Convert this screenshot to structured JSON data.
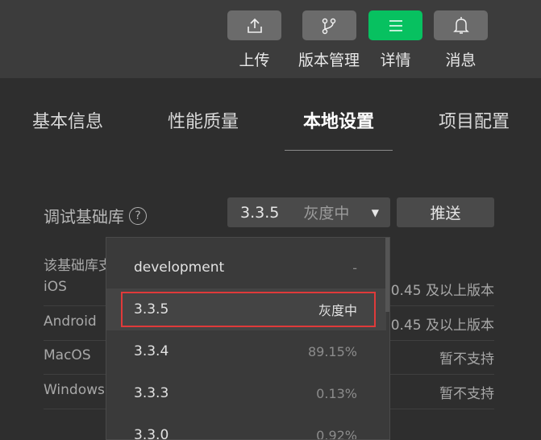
{
  "toolbar": {
    "upload_label": "上传",
    "version_label": "版本管理",
    "details_label": "详情",
    "messages_label": "消息",
    "accent_color": "#07c160"
  },
  "tabs": [
    {
      "label": "基本信息"
    },
    {
      "label": "性能质量"
    },
    {
      "label": "本地设置"
    },
    {
      "label": "项目配置"
    }
  ],
  "settings": {
    "debug_lib_label": "调试基础库",
    "help_glyph": "?",
    "selected_version": "3.3.5",
    "selected_status": "灰度中",
    "push_label": "推送"
  },
  "support": {
    "title": "该基础库支",
    "rows": [
      {
        "platform": "iOS",
        "requirement": "0.45 及以上版本"
      },
      {
        "platform": "Android",
        "requirement": "0.45 及以上版本"
      },
      {
        "platform": "MacOS",
        "requirement": "暂不支持"
      },
      {
        "platform": "Windows",
        "requirement": "暂不支持"
      }
    ]
  },
  "dropdown": {
    "items": [
      {
        "version": "development",
        "share": "-"
      },
      {
        "version": "3.3.5",
        "share": "灰度中"
      },
      {
        "version": "3.3.4",
        "share": "89.15%"
      },
      {
        "version": "3.3.3",
        "share": "0.13%"
      },
      {
        "version": "3.3.0",
        "share": "0.92%"
      }
    ]
  }
}
